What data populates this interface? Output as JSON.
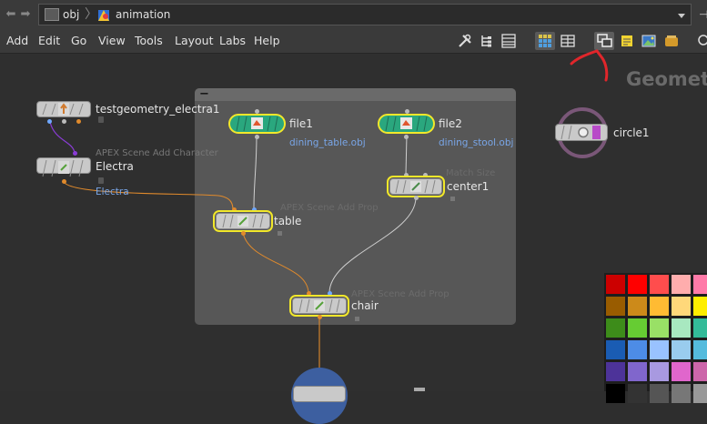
{
  "pathbar": {
    "back_icon": "left-arrow-icon",
    "forward_icon": "right-arrow-icon",
    "crumbs": [
      "obj",
      "animation"
    ],
    "dropdown_icon": "chevron-down-icon"
  },
  "menu": {
    "items": [
      "Add",
      "Edit",
      "Go",
      "View",
      "Tools",
      "Layout",
      "Labs",
      "Help"
    ]
  },
  "toolbar": {
    "icons": [
      "wrench-icon",
      "tree-view-icon",
      "list-view-icon",
      "grid-view-icon",
      "table-view-icon",
      "network-overview-icon",
      "sticky-note-icon",
      "image-icon",
      "backdrop-icon"
    ]
  },
  "network_box": {
    "collapse_label": "−"
  },
  "context_title": "Geomet",
  "nodes": {
    "testgeometry": {
      "label": "testgeometry_electra1"
    },
    "electra": {
      "type": "APEX Scene Add Character",
      "label": "Electra",
      "sub": "Electra"
    },
    "file1": {
      "label": "file1",
      "sub": "dining_table.obj"
    },
    "file2": {
      "label": "file2",
      "sub": "dining_stool.obj"
    },
    "center1": {
      "type": "Match Size",
      "label": "center1"
    },
    "table": {
      "type": "APEX Scene Add Prop",
      "label": "table"
    },
    "chair": {
      "type": "APEX Scene Add Prop",
      "label": "chair"
    },
    "circle1": {
      "label": "circle1"
    }
  },
  "colors": {
    "annotation_red": "#e0262b",
    "selection_yellow": "#f2e82a",
    "file_node_teal": "#2aa77e",
    "wire_orange": "#e08a2c",
    "circle_ring": "#7a5778"
  },
  "palette": [
    [
      "#cc0000",
      "#ff0000",
      "#ff4d4d",
      "#ffadad",
      "#ff7aa8"
    ],
    [
      "#995c00",
      "#cc8a1a",
      "#ffbb33",
      "#ffd87a",
      "#ffee00"
    ],
    [
      "#3d8c1a",
      "#66cc33",
      "#99e066",
      "#a8e8c0",
      "#33bb99"
    ],
    [
      "#1a5cb3",
      "#4d8ce6",
      "#99c2ff",
      "#99ccee",
      "#55bbdd"
    ],
    [
      "#4d3399",
      "#8066cc",
      "#a899e0",
      "#e066cc",
      "#cc66aa"
    ],
    [
      "#000000",
      "#333333",
      "#555555",
      "#777777",
      "#999999"
    ]
  ]
}
